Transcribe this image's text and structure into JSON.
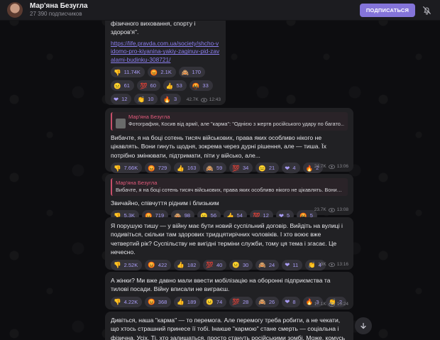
{
  "header": {
    "channel_name": "Мар'яна Безугла",
    "subscribers": "27 390 подписчиков",
    "subscribe_label": "ПОДПИСАТЬСЯ"
  },
  "posts": [
    {
      "text": "фізичного виховання, спорту і здоров'я\".",
      "link": "https://life.pravda.com.ua/society/shcho-vidomo-pro-kiyanina-yakiy-zaginuv-pid-zavalami-budinku-308721/",
      "reactions": [
        {
          "emoji": "👎",
          "count": "11.74K"
        },
        {
          "emoji": "😡",
          "count": "2.1K"
        },
        {
          "emoji": "🙈",
          "count": "170"
        },
        {
          "emoji": "😐",
          "count": "61"
        },
        {
          "emoji": "💯",
          "count": "60"
        },
        {
          "emoji": "👍",
          "count": "53"
        },
        {
          "emoji": "🤬",
          "count": "33"
        },
        {
          "emoji": "❤",
          "count": "12"
        },
        {
          "emoji": "👏",
          "count": "10"
        },
        {
          "emoji": "🔥",
          "count": "3"
        }
      ],
      "views": "42.7K",
      "time": "12:43"
    },
    {
      "reply": {
        "author": "Мар'яна Безугла",
        "text": "Фотография, Косив від армії, але \"карма\": \"Однією з жертв російського удару по багато..."
      },
      "text": "Вибачте, я на боці сотень тисяч військових, права яких особливо нікого не цікавлять. Вони гинуть щодня, зокрема через дурні рішення, але — тиша. Їх потрібно змінювати, підтримати, піти у військо, але...",
      "reactions": [
        {
          "emoji": "👎",
          "count": "7.66K"
        },
        {
          "emoji": "😡",
          "count": "729"
        },
        {
          "emoji": "👍",
          "count": "163"
        },
        {
          "emoji": "🙈",
          "count": "59"
        },
        {
          "emoji": "💯",
          "count": "34"
        },
        {
          "emoji": "😐",
          "count": "21"
        },
        {
          "emoji": "❤",
          "count": "4"
        },
        {
          "emoji": "🔥",
          "count": "2"
        }
      ],
      "views": "24.7K",
      "time": "13:06"
    },
    {
      "reply": {
        "author": "Мар'яна Безугла",
        "text": "Вибачте, я на боці сотень тисяч військових, права яких особливо нікого не цікавлять. Вони г..."
      },
      "text": "Звичайно, співчуття рідним і близьким",
      "reactions": [
        {
          "emoji": "👎",
          "count": "5.3K"
        },
        {
          "emoji": "😡",
          "count": "719"
        },
        {
          "emoji": "🙈",
          "count": "98"
        },
        {
          "emoji": "😐",
          "count": "56"
        },
        {
          "emoji": "👍",
          "count": "54"
        },
        {
          "emoji": "💯",
          "count": "12"
        },
        {
          "emoji": "❤",
          "count": "5"
        },
        {
          "emoji": "🤬",
          "count": "5"
        }
      ],
      "views": "23.7K",
      "time": "13:08"
    },
    {
      "text": "Я порушую тишу — у війну має бути новий суспільний договір. Вийдіть на вулиці і подивіться, скільки там здорових тридцятирічних чоловіків. І хто воює вже четвертий рік? Суспільству не вигідні терміни служби, тому ця тема і згасає. Це нечесно.",
      "reactions": [
        {
          "emoji": "👎",
          "count": "2.52K"
        },
        {
          "emoji": "😡",
          "count": "422"
        },
        {
          "emoji": "👍",
          "count": "182"
        },
        {
          "emoji": "💯",
          "count": "40"
        },
        {
          "emoji": "😐",
          "count": "30"
        },
        {
          "emoji": "🙈",
          "count": "24"
        },
        {
          "emoji": "❤",
          "count": "11"
        },
        {
          "emoji": "👏",
          "count": "4"
        },
        {
          "emoji": "🔥",
          "count": "3"
        }
      ],
      "views": "19K",
      "time": "13:16"
    },
    {
      "text": "А жінки? Ми вже давно мали ввести мобілізацію на оборонні підприємства та тилові посади. Війну вписали не виграєш.",
      "reactions": [
        {
          "emoji": "👎",
          "count": "4.22K"
        },
        {
          "emoji": "😡",
          "count": "368"
        },
        {
          "emoji": "👍",
          "count": "189"
        },
        {
          "emoji": "😐",
          "count": "74"
        },
        {
          "emoji": "💯",
          "count": "28"
        },
        {
          "emoji": "🙈",
          "count": "26"
        },
        {
          "emoji": "❤",
          "count": "8"
        },
        {
          "emoji": "🔥",
          "count": "3"
        },
        {
          "emoji": "👏",
          "count": "2"
        }
      ],
      "views": "17.1K",
      "time": "13:24"
    },
    {
      "text": "Дивіться, наша \"карма\" — то перемога. Але перемогу треба робити, а не чекати, що хтось страшний принесе її тобі. Інакше \"кармою\" стане смерть — соціальна і фізична. Усіх. Ті, хто залишаться, просто стануть російськими зомбі. Може, комусь то й Ок,"
    }
  ]
}
